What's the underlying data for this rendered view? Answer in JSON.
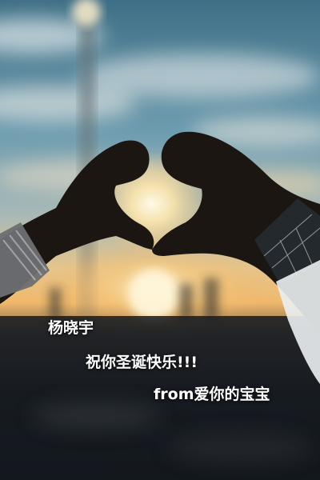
{
  "photo": {
    "subject": "heart-hands-silhouette",
    "colors": {
      "sky_top": "#4f7f95",
      "sky_mid": "#7fa9b8",
      "horizon_glow": "#f4c67a",
      "sun": "#fff3cf",
      "hands": "#1b1612",
      "ground": "#151a20"
    }
  },
  "captions": {
    "name": "杨晓宇",
    "wish": "祝你圣诞快乐!!!",
    "from": "from爱你的宝宝"
  }
}
